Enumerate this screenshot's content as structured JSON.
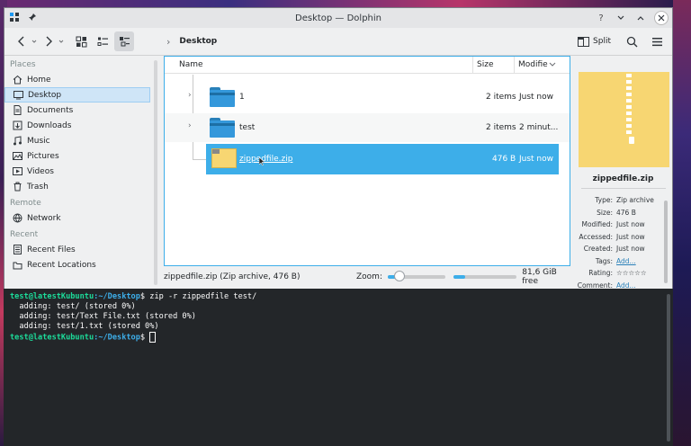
{
  "window": {
    "title": "Desktop — Dolphin"
  },
  "titlebar_buttons": [
    "?",
    "⌵",
    "⌃",
    "✕"
  ],
  "toolbar": {
    "breadcrumb": "Desktop",
    "split_label": "Split"
  },
  "sidebar": {
    "sections": [
      {
        "title": "Places",
        "items": [
          {
            "label": "Home",
            "icon": "home-icon"
          },
          {
            "label": "Desktop",
            "icon": "desktop-icon",
            "active": true
          },
          {
            "label": "Documents",
            "icon": "documents-icon"
          },
          {
            "label": "Downloads",
            "icon": "downloads-icon"
          },
          {
            "label": "Music",
            "icon": "music-icon"
          },
          {
            "label": "Pictures",
            "icon": "pictures-icon"
          },
          {
            "label": "Videos",
            "icon": "videos-icon"
          },
          {
            "label": "Trash",
            "icon": "trash-icon"
          }
        ]
      },
      {
        "title": "Remote",
        "items": [
          {
            "label": "Network",
            "icon": "network-icon"
          }
        ]
      },
      {
        "title": "Recent",
        "items": [
          {
            "label": "Recent Files",
            "icon": "recent-files-icon"
          },
          {
            "label": "Recent Locations",
            "icon": "recent-locations-icon"
          }
        ]
      }
    ]
  },
  "file_list": {
    "columns": [
      "Name",
      "Size",
      "Modifie"
    ],
    "rows": [
      {
        "name": "1",
        "size": "2 items",
        "modified": "Just now",
        "type": "folder"
      },
      {
        "name": "test",
        "size": "2 items",
        "modified": "2 minut...",
        "type": "folder"
      },
      {
        "name": "zippedfile.zip",
        "size": "476 B",
        "modified": "Just now",
        "type": "zip",
        "selected": true
      }
    ]
  },
  "statusbar": {
    "text": "zippedfile.zip (Zip archive, 476 B)",
    "zoom_label": "Zoom:",
    "zoom_level": 0.2,
    "free_space": "81,6 GiB free",
    "used_fraction": 0.18
  },
  "info_panel": {
    "filename": "zippedfile.zip",
    "meta": [
      {
        "key": "Type:",
        "value": "Zip archive"
      },
      {
        "key": "Size:",
        "value": "476 B"
      },
      {
        "key": "Modified:",
        "value": "Just now"
      },
      {
        "key": "Accessed:",
        "value": "Just now"
      },
      {
        "key": "Created:",
        "value": "Just now"
      },
      {
        "key": "Tags:",
        "value": "Add...",
        "link": true
      },
      {
        "key": "Rating:",
        "value": "☆☆☆☆☆"
      },
      {
        "key": "Comment:",
        "value": "Add...",
        "link": true
      }
    ]
  },
  "terminal": {
    "user": "test@latestKubuntu",
    "path": "~/Desktop",
    "command": "zip -r zippedfile test/",
    "output": [
      "  adding: test/ (stored 0%)",
      "  adding: test/Text File.txt (stored 0%)",
      "  adding: test/1.txt (stored 0%)"
    ]
  }
}
